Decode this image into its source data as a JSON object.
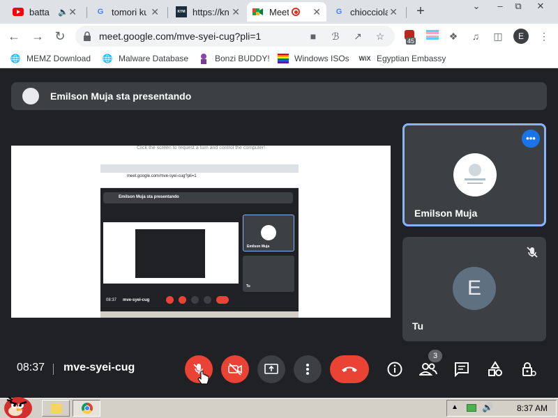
{
  "browser": {
    "tabs": [
      {
        "title": "batta",
        "icon": "youtube-icon"
      },
      {
        "title": "tomori ku",
        "icon": "google-icon"
      },
      {
        "title": "https://kn",
        "icon": "know-your-meme-icon"
      },
      {
        "title": "Meet",
        "icon": "google-meet-icon"
      },
      {
        "title": "chiocciola",
        "icon": "google-icon"
      }
    ],
    "new_tab": "+",
    "address": "meet.google.com/mve-syei-cug?pli=1",
    "extension_badge": "45",
    "profile_initial": "E",
    "bookmarks": [
      {
        "label": "MEMZ Download",
        "icon": "globe-icon"
      },
      {
        "label": "Malware Database",
        "icon": "globe-icon"
      },
      {
        "label": "Bonzi BUDDY!",
        "icon": "bonzi-icon"
      },
      {
        "label": "Windows ISOs",
        "icon": "windows-icon"
      },
      {
        "label": "Egyptian Embassy",
        "icon": "wix-icon"
      }
    ],
    "wix_mark": "WiX"
  },
  "meet": {
    "presenting_banner": "Emilson Muja sta presentando",
    "screen_hint": "Click the screen to request a turn and control the computer!",
    "nested": {
      "banner": "Emilson Muja sta presentando",
      "address": "meet.google.com/mve-syei-cug?pli=1",
      "tile1": "Emilson Muja",
      "tile2": "Tu",
      "clock": "08:37",
      "code": "mve-syei-cug"
    },
    "participants": [
      {
        "name": "Emilson Muja",
        "more": "•••"
      },
      {
        "name": "Tu",
        "initial": "E"
      }
    ],
    "clock": "08:37",
    "meeting_code": "mve-syei-cug",
    "people_count": "3"
  },
  "taskbar": {
    "time": "8:37 AM"
  },
  "colors": {
    "meet_bg": "#202124",
    "tile_bg": "#3c4043",
    "red": "#ea4335",
    "blue": "#1a73e8",
    "highlight": "#8ab4f8"
  }
}
